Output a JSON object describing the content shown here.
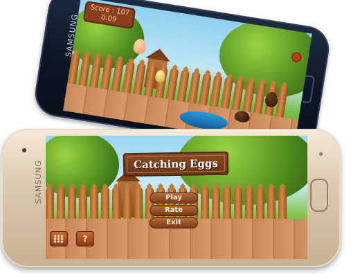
{
  "back_device": {
    "brand": "SAMSUNG",
    "game": {
      "score_label": "Score : 107",
      "timer": "0:09"
    }
  },
  "front_device": {
    "brand": "SAMSUNG",
    "game": {
      "title": "Catching Eggs",
      "menu": [
        {
          "label": "Play"
        },
        {
          "label": "Rate"
        },
        {
          "label": "Exit"
        }
      ],
      "bottom_buttons": {
        "grid_icon": "grid-icon",
        "help_label": "?"
      }
    }
  }
}
